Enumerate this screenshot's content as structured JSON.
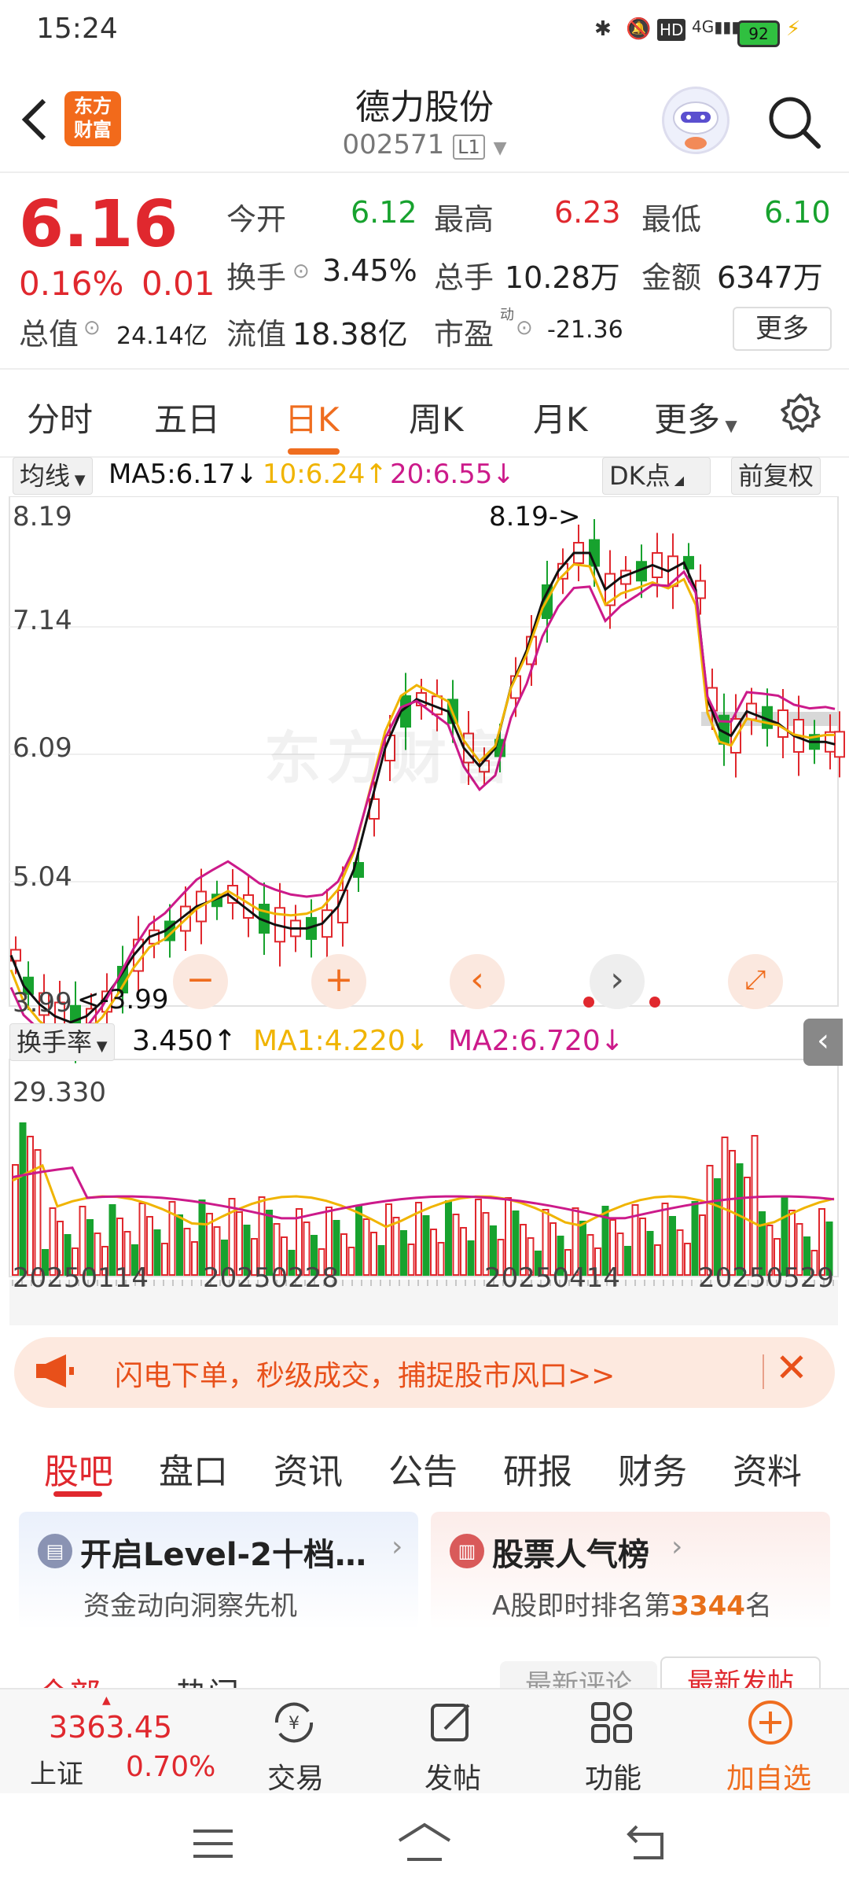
{
  "status": {
    "time": "15:24",
    "battery": "92"
  },
  "header": {
    "title": "德力股份",
    "code": "002571",
    "level": "L1",
    "logo_line1": "东方",
    "logo_line2": "财富"
  },
  "quote": {
    "price": "6.16",
    "change_pct": "0.16%",
    "change": "0.01",
    "open_label": "今开",
    "open": "6.12",
    "high_label": "最高",
    "high": "6.23",
    "low_label": "最低",
    "low": "6.10",
    "turnover_label": "换手",
    "turnover": "3.45%",
    "volume_label": "总手",
    "volume": "10.28万",
    "amount_label": "金额",
    "amount": "6347万",
    "mktcap_label": "总值",
    "mktcap": "24.14亿",
    "float_label": "流值",
    "float": "18.38亿",
    "pe_label": "市盈",
    "pe_sup": "动",
    "pe": "-21.36",
    "more": "更多"
  },
  "ktabs": [
    "分时",
    "五日",
    "日K",
    "周K",
    "月K",
    "更多"
  ],
  "chart": {
    "ma_select": "均线",
    "ma5": "MA5:6.17↓",
    "ma10": "10:6.24↑",
    "ma20": "20:6.55↓",
    "dk": "DK点",
    "fq": "前复权",
    "yticks": [
      "8.19",
      "7.14",
      "6.09",
      "5.04",
      "3.99"
    ],
    "high_mark": "8.19->",
    "low_mark": "<-3.99",
    "watermark": "东方财富",
    "ind_select": "换手率",
    "ind_value": "3.450↑",
    "ma1": "MA1:4.220↓",
    "ma2": "MA2:6.720↓",
    "ind_max": "29.330",
    "dates": [
      "20250114",
      "20250228",
      "20250414",
      "20250529"
    ],
    "colors": {
      "up": "#e0282e",
      "down": "#17a22e",
      "ma5": "#111111",
      "ma10": "#f0b400",
      "ma20": "#cc1a8a"
    }
  },
  "banner": {
    "text": "闪电下单，秒级成交，捕捉股市风口>>"
  },
  "tabs2": [
    "股吧",
    "盘口",
    "资讯",
    "公告",
    "研报",
    "财务",
    "资料"
  ],
  "cards": {
    "left_title": "开启Level-2十档…",
    "left_sub": "资金动向洞察先机",
    "right_title": "股票人气榜",
    "right_sub_pre": "A股即时排名第",
    "right_rank": "3344",
    "right_sub_post": "名"
  },
  "peek": {
    "all": "全部",
    "hot": "热门",
    "latest_reply": "最新评论",
    "latest_post": "最新发帖"
  },
  "bottomnav": {
    "index_value": "3363.45",
    "index_name": "上证",
    "index_pct": "0.70%",
    "trade": "交易",
    "post": "发帖",
    "func": "功能",
    "add": "加自选"
  }
}
